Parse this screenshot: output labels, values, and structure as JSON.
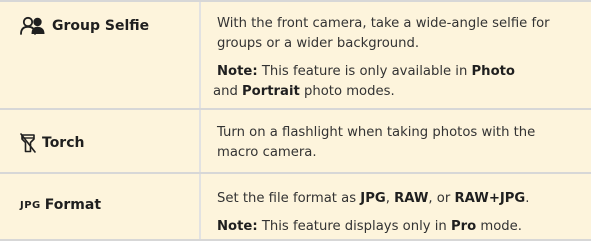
{
  "rows": [
    {
      "feature": "Group Selfie",
      "icon": "group-selfie-icon",
      "description": "With the front camera, take a wide-angle selfie for groups or a wider background.",
      "note": {
        "label": "Note:",
        "text_1": " This feature is only available in ",
        "bold_1": "Photo",
        "text_2": " and ",
        "bold_2": "Portrait",
        "text_3": " photo modes."
      }
    },
    {
      "feature": "Torch",
      "icon": "torch-icon",
      "description": "Turn on a flashlight when taking photos with the macro camera."
    },
    {
      "feature": "Format",
      "icon_text": "JPG",
      "icon": "jpg-format-icon",
      "description": {
        "text_1": "Set the file format as ",
        "bold_1": "JPG",
        "text_2": ", ",
        "bold_2": "RAW",
        "text_3": ", or ",
        "bold_3": "RAW+JPG",
        "text_4": "."
      },
      "note": {
        "label": "Note:",
        "text_1": " This feature displays only in ",
        "bold_1": "Pro",
        "text_2": " mode."
      }
    }
  ],
  "colors": {
    "background": "#fdf4dc",
    "divider": "#d7d7d7",
    "text": "#333333"
  }
}
